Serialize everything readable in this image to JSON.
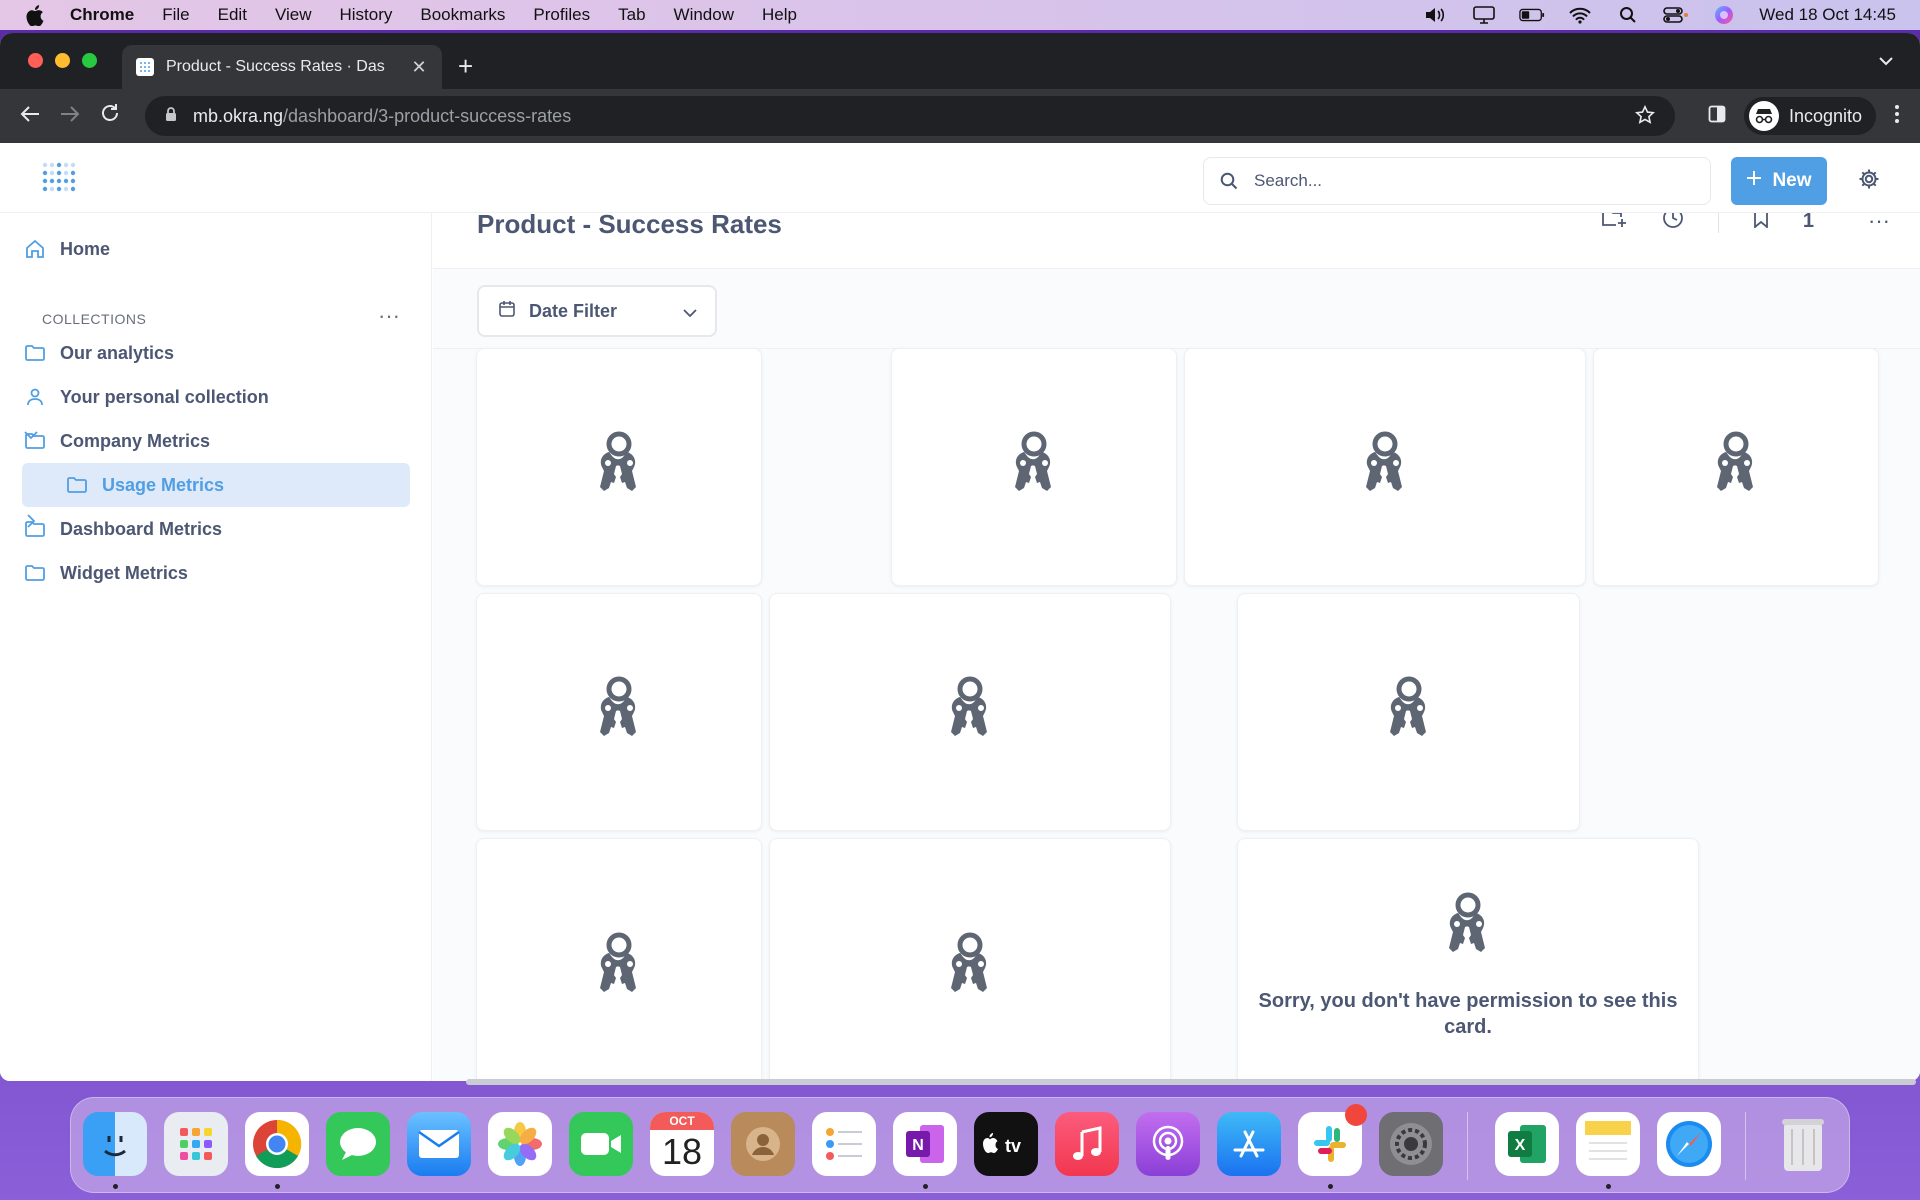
{
  "menubar": {
    "app": "Chrome",
    "items": [
      "File",
      "Edit",
      "View",
      "History",
      "Bookmarks",
      "Profiles",
      "Tab",
      "Window",
      "Help"
    ],
    "clock": "Wed 18 Oct  14:45"
  },
  "browser": {
    "tab_title": "Product - Success Rates · Das",
    "url_host": "mb.okra.ng",
    "url_path": "/dashboard/3-product-success-rates",
    "profile_label": "Incognito"
  },
  "topnav": {
    "search_placeholder": "Search...",
    "new_label": "New"
  },
  "sidebar": {
    "home": "Home",
    "collections_heading": "COLLECTIONS",
    "items": [
      {
        "label": "Our analytics"
      },
      {
        "label": "Your personal collection"
      },
      {
        "label": "Company Metrics"
      },
      {
        "label": "Usage Metrics"
      },
      {
        "label": "Dashboard Metrics"
      },
      {
        "label": "Widget Metrics"
      }
    ]
  },
  "dashboard": {
    "title": "Product - Success Rates",
    "subscriber_count": "1",
    "date_filter_label": "Date Filter",
    "permission_message": "Sorry, you don't have permission to see this card."
  },
  "dock": {
    "calendar_month": "OCT",
    "calendar_day": "18",
    "apps": [
      "Finder",
      "Launchpad",
      "Chrome",
      "Messages",
      "Mail",
      "Photos",
      "FaceTime",
      "Calendar",
      "Contacts",
      "Reminders",
      "OneNote",
      "Apple TV",
      "Music",
      "Podcasts",
      "App Store",
      "Slack",
      "System Settings",
      "Excel",
      "Notes",
      "Safari",
      "Trash"
    ]
  },
  "colors": {
    "brand": "#509ee3",
    "text": "#4c5773",
    "active_bg": "#deeaf9"
  }
}
